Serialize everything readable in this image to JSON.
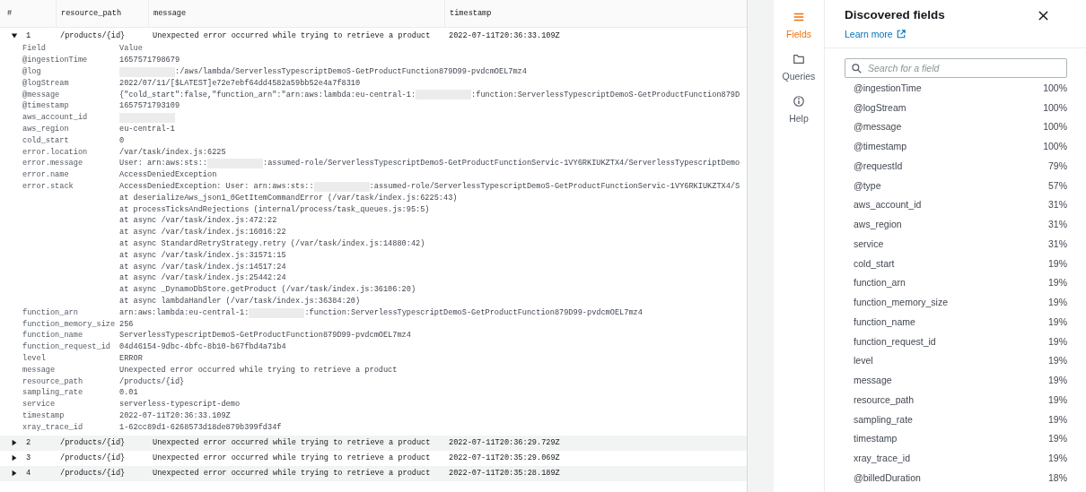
{
  "results_table": {
    "columns": [
      "#",
      "resource_path",
      "message",
      "timestamp"
    ],
    "rows": [
      {
        "number": "1",
        "resource_path": "/products/{id}",
        "message": "Unexpected error occurred while trying to retrieve a product",
        "timestamp": "2022-07-11T20:36:33.109Z",
        "expanded": true,
        "details": {
          "columns": [
            "Field",
            "Value"
          ],
          "fields": [
            {
              "name": "@ingestionTime",
              "lines": [
                [
                  {
                    "kind": "text",
                    "text": "1657571798679"
                  }
                ]
              ]
            },
            {
              "name": "@log",
              "lines": [
                [
                  {
                    "kind": "redacted"
                  },
                  {
                    "kind": "text",
                    "text": ":/aws/lambda/ServerlessTypescriptDemoS-GetProductFunction879D99-pvdcmOEL7mz4"
                  }
                ]
              ]
            },
            {
              "name": "@logStream",
              "lines": [
                [
                  {
                    "kind": "text",
                    "text": "2022/07/11/[$LATEST]e72e7ebf64dd4582a59bb52e4a7f8310"
                  }
                ]
              ]
            },
            {
              "name": "@message",
              "lines": [
                [
                  {
                    "kind": "text",
                    "text": "{\"cold_start\":false,\"function_arn\":\"arn:aws:lambda:eu-central-1:"
                  },
                  {
                    "kind": "redacted"
                  },
                  {
                    "kind": "text",
                    "text": ":function:ServerlessTypescriptDemoS-GetProductFunction879D"
                  }
                ]
              ]
            },
            {
              "name": "@timestamp",
              "lines": [
                [
                  {
                    "kind": "text",
                    "text": "1657571793109"
                  }
                ]
              ]
            },
            {
              "name": "aws_account_id",
              "lines": [
                [
                  {
                    "kind": "redacted"
                  }
                ]
              ]
            },
            {
              "name": "aws_region",
              "lines": [
                [
                  {
                    "kind": "text",
                    "text": "eu-central-1"
                  }
                ]
              ]
            },
            {
              "name": "cold_start",
              "lines": [
                [
                  {
                    "kind": "text",
                    "text": "0"
                  }
                ]
              ]
            },
            {
              "name": "error.location",
              "lines": [
                [
                  {
                    "kind": "text",
                    "text": "/var/task/index.js:6225"
                  }
                ]
              ]
            },
            {
              "name": "error.message",
              "lines": [
                [
                  {
                    "kind": "text",
                    "text": "User: arn:aws:sts::"
                  },
                  {
                    "kind": "redacted"
                  },
                  {
                    "kind": "text",
                    "text": ":assumed-role/ServerlessTypescriptDemoS-GetProductFunctionServic-1VY6RKIUKZTX4/ServerlessTypescriptDemo"
                  }
                ]
              ]
            },
            {
              "name": "error.name",
              "lines": [
                [
                  {
                    "kind": "text",
                    "text": "AccessDeniedException"
                  }
                ]
              ]
            },
            {
              "name": "error.stack",
              "lines": [
                [
                  {
                    "kind": "text",
                    "text": "AccessDeniedException: User: arn:aws:sts::"
                  },
                  {
                    "kind": "redacted"
                  },
                  {
                    "kind": "text",
                    "text": ":assumed-role/ServerlessTypescriptDemoS-GetProductFunctionServic-1VY6RKIUKZTX4/S"
                  }
                ],
                [
                  {
                    "kind": "text",
                    "text": "at deserializeAws_json1_0GetItemCommandError (/var/task/index.js:6225:43)"
                  }
                ],
                [
                  {
                    "kind": "text",
                    "text": "at processTicksAndRejections (internal/process/task_queues.js:95:5)"
                  }
                ],
                [
                  {
                    "kind": "text",
                    "text": "at async /var/task/index.js:472:22"
                  }
                ],
                [
                  {
                    "kind": "text",
                    "text": "at async /var/task/index.js:16016:22"
                  }
                ],
                [
                  {
                    "kind": "text",
                    "text": "at async StandardRetryStrategy.retry (/var/task/index.js:14880:42)"
                  }
                ],
                [
                  {
                    "kind": "text",
                    "text": "at async /var/task/index.js:31571:15"
                  }
                ],
                [
                  {
                    "kind": "text",
                    "text": "at async /var/task/index.js:14517:24"
                  }
                ],
                [
                  {
                    "kind": "text",
                    "text": "at async /var/task/index.js:25442:24"
                  }
                ],
                [
                  {
                    "kind": "text",
                    "text": "at async _DynamoDbStore.getProduct (/var/task/index.js:36106:20)"
                  }
                ],
                [
                  {
                    "kind": "text",
                    "text": "at async lambdaHandler (/var/task/index.js:36384:20)"
                  }
                ]
              ]
            },
            {
              "name": "function_arn",
              "lines": [
                [
                  {
                    "kind": "text",
                    "text": "arn:aws:lambda:eu-central-1:"
                  },
                  {
                    "kind": "redacted"
                  },
                  {
                    "kind": "text",
                    "text": ":function:ServerlessTypescriptDemoS-GetProductFunction879D99-pvdcmOEL7mz4"
                  }
                ]
              ]
            },
            {
              "name": "function_memory_size",
              "lines": [
                [
                  {
                    "kind": "text",
                    "text": "256"
                  }
                ]
              ]
            },
            {
              "name": "function_name",
              "lines": [
                [
                  {
                    "kind": "text",
                    "text": "ServerlessTypescriptDemoS-GetProductFunction879D99-pvdcmOEL7mz4"
                  }
                ]
              ]
            },
            {
              "name": "function_request_id",
              "lines": [
                [
                  {
                    "kind": "text",
                    "text": "04d46154-9dbc-4bfc-8b10-b67fbd4a71b4"
                  }
                ]
              ]
            },
            {
              "name": "level",
              "lines": [
                [
                  {
                    "kind": "text",
                    "text": "ERROR"
                  }
                ]
              ]
            },
            {
              "name": "message",
              "lines": [
                [
                  {
                    "kind": "text",
                    "text": "Unexpected error occurred while trying to retrieve a product"
                  }
                ]
              ]
            },
            {
              "name": "resource_path",
              "lines": [
                [
                  {
                    "kind": "text",
                    "text": "/products/{id}"
                  }
                ]
              ]
            },
            {
              "name": "sampling_rate",
              "lines": [
                [
                  {
                    "kind": "text",
                    "text": "0.01"
                  }
                ]
              ]
            },
            {
              "name": "service",
              "lines": [
                [
                  {
                    "kind": "text",
                    "text": "serverless-typescript-demo"
                  }
                ]
              ]
            },
            {
              "name": "timestamp",
              "lines": [
                [
                  {
                    "kind": "text",
                    "text": "2022-07-11T20:36:33.109Z"
                  }
                ]
              ]
            },
            {
              "name": "xray_trace_id",
              "lines": [
                [
                  {
                    "kind": "text",
                    "text": "1-62cc89d1-6268573d18de879b399fd34f"
                  }
                ]
              ]
            }
          ]
        }
      },
      {
        "number": "2",
        "resource_path": "/products/{id}",
        "message": "Unexpected error occurred while trying to retrieve a product",
        "timestamp": "2022-07-11T20:36:29.729Z",
        "expanded": false
      },
      {
        "number": "3",
        "resource_path": "/products/{id}",
        "message": "Unexpected error occurred while trying to retrieve a product",
        "timestamp": "2022-07-11T20:35:29.069Z",
        "expanded": false
      },
      {
        "number": "4",
        "resource_path": "/products/{id}",
        "message": "Unexpected error occurred while trying to retrieve a product",
        "timestamp": "2022-07-11T20:35:28.189Z",
        "expanded": false
      }
    ]
  },
  "nav": [
    {
      "label": "Fields",
      "selected": true
    },
    {
      "label": "Queries",
      "selected": false
    },
    {
      "label": "Help",
      "selected": false
    }
  ],
  "fields_panel": {
    "title": "Discovered fields",
    "link": "Learn more",
    "search": {
      "placeholder": "Search for a field"
    },
    "fields": [
      {
        "name": "@ingestionTime",
        "percent": "100%"
      },
      {
        "name": "@logStream",
        "percent": "100%"
      },
      {
        "name": "@message",
        "percent": "100%"
      },
      {
        "name": "@timestamp",
        "percent": "100%"
      },
      {
        "name": "@requestId",
        "percent": "79%"
      },
      {
        "name": "@type",
        "percent": "57%"
      },
      {
        "name": "aws_account_id",
        "percent": "31%"
      },
      {
        "name": "aws_region",
        "percent": "31%"
      },
      {
        "name": "service",
        "percent": "31%"
      },
      {
        "name": "cold_start",
        "percent": "19%"
      },
      {
        "name": "function_arn",
        "percent": "19%"
      },
      {
        "name": "function_memory_size",
        "percent": "19%"
      },
      {
        "name": "function_name",
        "percent": "19%"
      },
      {
        "name": "function_request_id",
        "percent": "19%"
      },
      {
        "name": "level",
        "percent": "19%"
      },
      {
        "name": "message",
        "percent": "19%"
      },
      {
        "name": "resource_path",
        "percent": "19%"
      },
      {
        "name": "sampling_rate",
        "percent": "19%"
      },
      {
        "name": "timestamp",
        "percent": "19%"
      },
      {
        "name": "xray_trace_id",
        "percent": "19%"
      },
      {
        "name": "@billedDuration",
        "percent": "18%"
      }
    ]
  }
}
